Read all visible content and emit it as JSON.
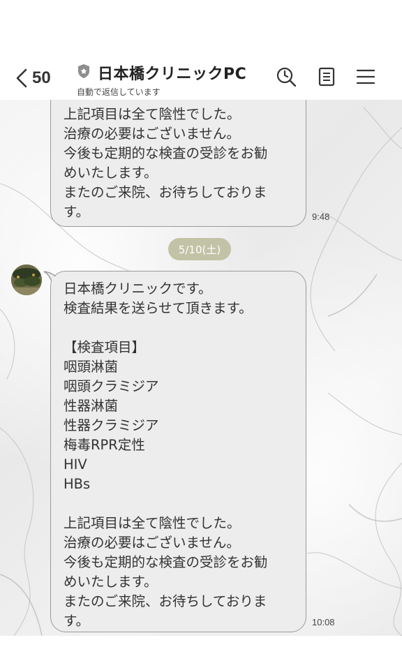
{
  "header": {
    "back_count": "50",
    "title": "日本橋クリニックPC",
    "subtitle": "自動で返信しています",
    "icons": {
      "back": "chevron-left-icon",
      "shield": "official-shield-icon",
      "search": "search-history-icon",
      "notes": "notes-icon",
      "menu": "hamburger-menu-icon"
    }
  },
  "messages": {
    "first": {
      "lines": [
        "上記項目は全て陰性でした。",
        "治療の必要はございません。",
        "今後も定期的な検査の受診をお勧",
        "めいたします。",
        "またのご来院、お待ちしておりま",
        "す。"
      ],
      "time": "9:48"
    },
    "date_separator": "5/10(土)",
    "second": {
      "lines": [
        "日本橋クリニックです。",
        "検査結果を送らせて頂きます。",
        "",
        "【検査項目】",
        "咽頭淋菌",
        "咽頭クラミジア",
        "性器淋菌",
        "性器クラミジア",
        "梅毒RPR定性",
        "HIV",
        "HBs",
        "",
        "上記項目は全て陰性でした。",
        "治療の必要はございません。",
        "今後も定期的な検査の受診をお勧",
        "めいたします。",
        "またのご来院、お待ちしておりま",
        "す。"
      ],
      "time": "10:08"
    }
  },
  "colors": {
    "bubble_bg": "#ededed",
    "bubble_border": "#9a9a9a",
    "date_pill": "#c2c2a6"
  }
}
